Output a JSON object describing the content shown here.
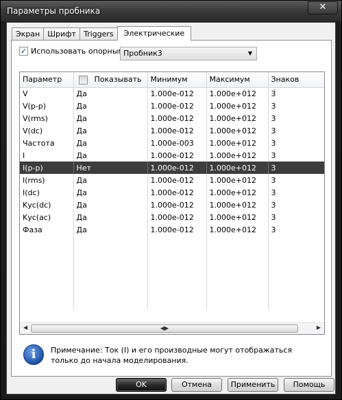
{
  "window": {
    "title": "Параметры пробника",
    "close": "✕"
  },
  "tabs": [
    "Экран",
    "Шрифт",
    "Triggers",
    "Электрические"
  ],
  "reference": {
    "checkbox_label": "Использовать опорным",
    "checked": "✓",
    "selected": "Пробник3"
  },
  "columns": [
    "Параметр",
    "Показывать",
    "Минимум",
    "Максимум",
    "Знаков"
  ],
  "rows": [
    [
      "V",
      "Да",
      "1.000e-012",
      "1.000e+012",
      "3"
    ],
    [
      "V(p-p)",
      "Да",
      "1.000e-012",
      "1.000e+012",
      "3"
    ],
    [
      "V(rms)",
      "Да",
      "1.000e-012",
      "1.000e+012",
      "3"
    ],
    [
      "V(dc)",
      "Да",
      "1.000e-012",
      "1.000e+012",
      "3"
    ],
    [
      "Частота",
      "Да",
      "1.000e-003",
      "1.000e+012",
      "3"
    ],
    [
      "I",
      "Да",
      "1.000e-012",
      "1.000e+012",
      "3"
    ],
    [
      "I(p-p)",
      "Нет",
      "1.000e-012",
      "1.000e+012",
      "3"
    ],
    [
      "I(rms)",
      "Да",
      "1.000e-012",
      "1.000e+012",
      "3"
    ],
    [
      "I(dc)",
      "Да",
      "1.000e-012",
      "1.000e+012",
      "3"
    ],
    [
      "Kус(dc)",
      "Да",
      "1.000e-012",
      "1.000e+012",
      "3"
    ],
    [
      "Kус(ac)",
      "Да",
      "1.000e-012",
      "1.000e+012",
      "3"
    ],
    [
      "Фаза",
      "Да",
      "1.000e-012",
      "1.000e+012",
      "3"
    ]
  ],
  "selected_row": 6,
  "note": "Примечание: Ток (I) и его производные могут отображаться только до начала моделирования.",
  "buttons": {
    "ok": "OK",
    "cancel": "Отмена",
    "apply": "Применить",
    "help": "Помощь"
  },
  "colors": {
    "selected_row": "#3d3d3d",
    "title_bar": "#2b2b2b"
  }
}
